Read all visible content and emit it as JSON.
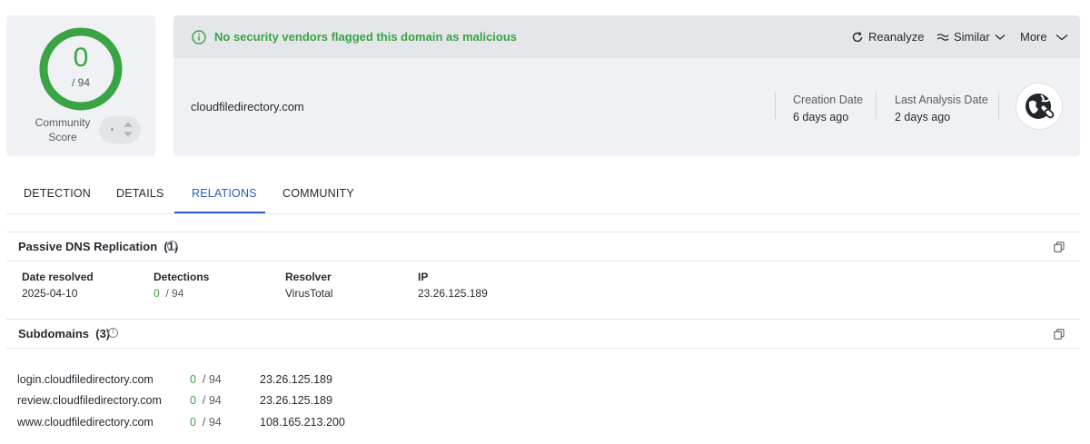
{
  "score": {
    "detections": "0",
    "total": "/ 94",
    "community_label_1": "Community",
    "community_label_2": "Score"
  },
  "banner": {
    "message": "No security vendors flagged this domain as malicious",
    "reanalyze": "Reanalyze",
    "similar": "Similar",
    "more": "More"
  },
  "domain": {
    "name": "cloudfiledirectory.com",
    "creation_label": "Creation Date",
    "creation_value": "6 days ago",
    "analysis_label": "Last Analysis Date",
    "analysis_value": "2 days ago"
  },
  "tabs": [
    {
      "label": "DETECTION"
    },
    {
      "label": "DETAILS"
    },
    {
      "label": "RELATIONS"
    },
    {
      "label": "COMMUNITY"
    }
  ],
  "passive_dns": {
    "title": "Passive DNS Replication",
    "count": "(1)",
    "headers": [
      "Date resolved",
      "Detections",
      "Resolver",
      "IP"
    ],
    "rows": [
      {
        "date": "2025-04-10",
        "detections": "0",
        "total": "/ 94",
        "resolver": "VirusTotal",
        "ip": "23.26.125.189"
      }
    ]
  },
  "subdomains": {
    "title": "Subdomains",
    "count": "(3)",
    "rows": [
      {
        "domain": "login.cloudfiledirectory.com",
        "detections": "0",
        "total": "/ 94",
        "ip": "23.26.125.189"
      },
      {
        "domain": "review.cloudfiledirectory.com",
        "detections": "0",
        "total": "/ 94",
        "ip": "23.26.125.189"
      },
      {
        "domain": "www.cloudfiledirectory.com",
        "detections": "0",
        "total": "/ 94",
        "ip": "108.165.213.200"
      }
    ]
  },
  "colors": {
    "clean": "#3aa445",
    "accent": "#2a5bbf"
  }
}
